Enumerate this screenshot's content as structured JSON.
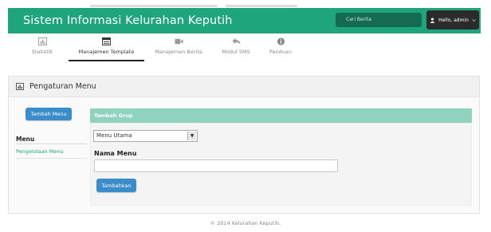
{
  "header": {
    "app_title": "Sistem Informasi Kelurahan Keputih",
    "search_placeholder": "Cari Berita",
    "user_greeting": "Hello, admin"
  },
  "tabs": [
    {
      "label": "Statistik",
      "icon": "bar-chart-icon"
    },
    {
      "label": "Manajemen Template",
      "icon": "template-icon",
      "active": true
    },
    {
      "label": "Manajemen Berita",
      "icon": "video-icon"
    },
    {
      "label": "Modul SMS",
      "icon": "reply-icon"
    },
    {
      "label": "Panduan",
      "icon": "info-icon"
    }
  ],
  "panel": {
    "title": "Pengaturan Menu",
    "icon": "bar-chart-icon"
  },
  "sidebar": {
    "add_button": "Tambah Menu",
    "section_title": "Menu",
    "link": "Pengelolaan Menu"
  },
  "form": {
    "group_header": "Tambah Grup",
    "select_value": "Menu Utama",
    "name_label": "Nama Menu",
    "name_value": "",
    "submit_label": "Tambahkan"
  },
  "footer": {
    "text": "© 2014 Kelurahan Keputih."
  },
  "colors": {
    "primary": "#1fa57c",
    "primary_light": "#8fd2bd",
    "button_blue": "#3b8cca",
    "dark": "#2b2b2b"
  }
}
